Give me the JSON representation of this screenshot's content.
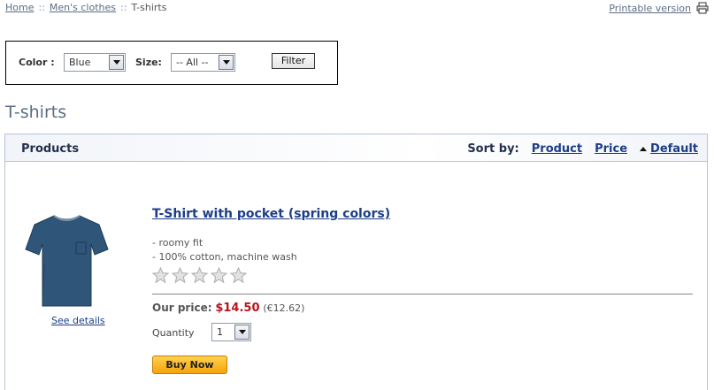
{
  "breadcrumb": {
    "items": [
      "Home",
      "Men's clothes",
      "T-shirts"
    ],
    "separator": "::"
  },
  "printable": {
    "label": "Printable version",
    "icon": "printer-icon"
  },
  "filter": {
    "color_label": "Color :",
    "color_value": "Blue",
    "size_label": "Size:",
    "size_value": "-- All --",
    "button_label": "Filter"
  },
  "page_title": "T-shirts",
  "products_panel": {
    "title": "Products",
    "sort_by_label": "Sort by:",
    "sort_options": [
      "Product",
      "Price",
      "Default"
    ],
    "active_sort": "Default",
    "active_sort_icon": "sort-ascending-icon"
  },
  "product": {
    "name": "T-Shirt with pocket (spring colors)",
    "description": [
      "- roomy fit",
      "- 100% cotton, machine wash"
    ],
    "rating_stars_filled": 0,
    "rating_stars_total": 5,
    "see_details": "See details",
    "our_price_label": "Our price:",
    "price": "$14.50",
    "alt_price": "(€12.62)",
    "quantity_label": "Quantity",
    "quantity_value": "1",
    "buy_label": "Buy Now",
    "image_color": "#2f5578"
  }
}
